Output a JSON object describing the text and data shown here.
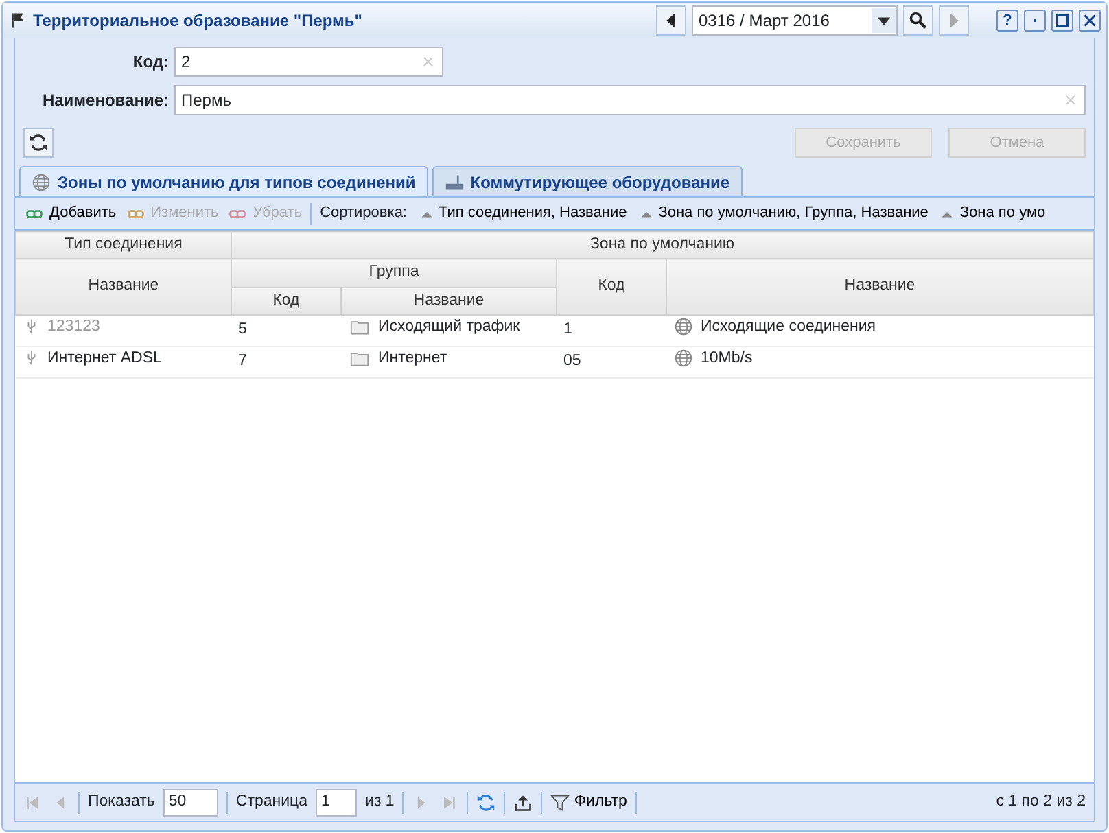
{
  "window": {
    "title": "Территориальное образование \"Пермь\"",
    "period": "0316 / Март 2016",
    "buttons": [
      "?"
    ]
  },
  "form": {
    "fields": [
      {
        "label": "Код:",
        "value": "2"
      },
      {
        "label": "Наименование:",
        "value": "Пермь"
      }
    ],
    "buttons": [
      {
        "label": "Сохранить",
        "disabled": true
      },
      {
        "label": "Отмена",
        "disabled": true
      }
    ]
  },
  "tabs": [
    {
      "label": "Зоны по умолчанию для типов соединений",
      "selected": true,
      "kind": "globe"
    },
    {
      "label": "Коммутирующее оборудование",
      "selected": false,
      "kind": "device"
    }
  ],
  "toolbar": {
    "actions": [
      {
        "label": "Добавить",
        "disabled": false
      },
      {
        "label": "Изменить",
        "disabled": true
      },
      {
        "label": "Убрать",
        "disabled": true
      }
    ],
    "sort_label": "Сортировка:",
    "sorts": [
      "Тип соединения, Название",
      "Зона по умолчанию, Группа, Название",
      "Зона по умо"
    ]
  },
  "table": {
    "header_groups": [
      "Тип соединения",
      "Зона по умолчанию"
    ],
    "subgroup": "Группа",
    "columns": [
      "Название",
      "Код",
      "Название",
      "Код",
      "Название"
    ],
    "rows": [
      {
        "disabled": true,
        "cells": [
          "123123",
          "5",
          "Исходящий трафик",
          "1",
          "Исходящие соединения"
        ]
      },
      {
        "disabled": false,
        "cells": [
          "Интернет ADSL",
          "7",
          "Интернет",
          "05",
          "10Mb/s"
        ]
      }
    ]
  },
  "pager": {
    "show_label": "Показать",
    "page_size": "50",
    "page_label": "Страница",
    "page": "1",
    "of": "из 1",
    "filter": "Фильтр",
    "summary": "с 1 по 2 из 2"
  }
}
